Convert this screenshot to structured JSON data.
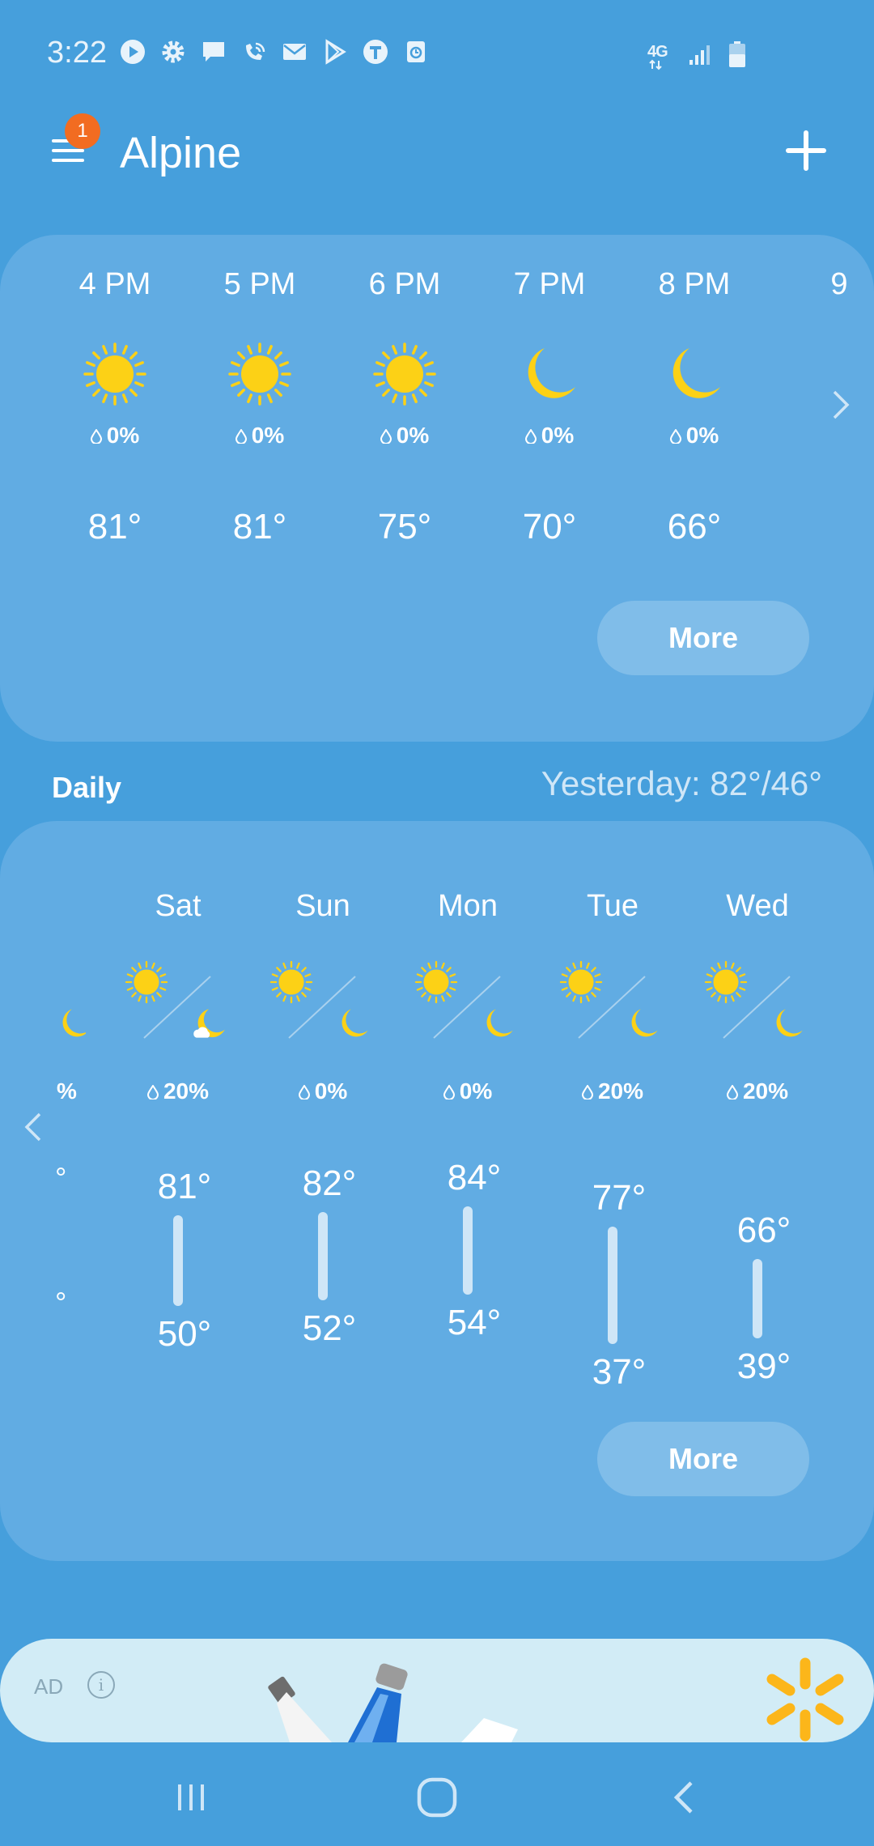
{
  "status": {
    "time": "3:22",
    "icons": [
      "play-icon",
      "settings-icon",
      "message-icon",
      "wifi-call-icon",
      "mail-icon",
      "play-store-icon",
      "t-icon",
      "alarm-icon"
    ],
    "network": "4G",
    "battery_level": 0.55
  },
  "header": {
    "city": "Alpine",
    "notification_count": "1"
  },
  "hourly": {
    "items": [
      {
        "time": "4 PM",
        "icon": "sun-icon",
        "precip": "0%",
        "temp": "81°"
      },
      {
        "time": "5 PM",
        "icon": "sun-icon",
        "precip": "0%",
        "temp": "81°"
      },
      {
        "time": "6 PM",
        "icon": "sun-icon",
        "precip": "0%",
        "temp": "75°"
      },
      {
        "time": "7 PM",
        "icon": "moon-icon",
        "precip": "0%",
        "temp": "70°"
      },
      {
        "time": "8 PM",
        "icon": "moon-icon",
        "precip": "0%",
        "temp": "66°"
      },
      {
        "time": "9",
        "icon": "moon-icon",
        "precip": "",
        "temp": ""
      }
    ],
    "more_label": "More"
  },
  "daily": {
    "title": "Daily",
    "yesterday": "Yesterday: 82°/46°",
    "partial_precip": "%",
    "partial_high": "°",
    "partial_low": "°",
    "items": [
      {
        "day": "Sat",
        "day_icon": "sun-icon",
        "night_icon": "moon-cloud-icon",
        "precip": "20%",
        "high": "81°",
        "low": "50°"
      },
      {
        "day": "Sun",
        "day_icon": "sun-icon",
        "night_icon": "moon-icon",
        "precip": "0%",
        "high": "82°",
        "low": "52°"
      },
      {
        "day": "Mon",
        "day_icon": "sun-icon",
        "night_icon": "moon-icon",
        "precip": "0%",
        "high": "84°",
        "low": "54°"
      },
      {
        "day": "Tue",
        "day_icon": "sun-icon",
        "night_icon": "moon-icon",
        "precip": "20%",
        "high": "77°",
        "low": "37°"
      },
      {
        "day": "Wed",
        "day_icon": "sun-icon",
        "night_icon": "moon-icon",
        "precip": "20%",
        "high": "66°",
        "low": "39°"
      }
    ],
    "more_label": "More"
  },
  "ad": {
    "label": "AD",
    "info": "i"
  },
  "colors": {
    "background": "#469fdc",
    "card": "#61ace3",
    "button": "#80bde9",
    "sun": "#fcd116",
    "badge": "#f26c21"
  }
}
